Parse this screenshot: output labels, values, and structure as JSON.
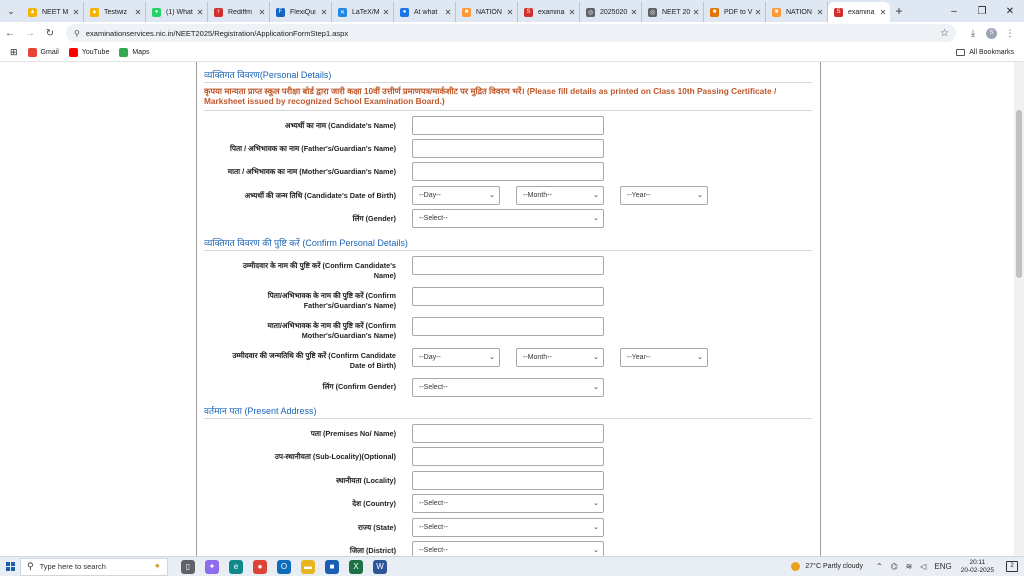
{
  "browser": {
    "tabs": [
      {
        "label": "NEET M",
        "color": "#f4b400",
        "glyph": "▲"
      },
      {
        "label": "Testwiz",
        "color": "#f4b400",
        "glyph": "▲"
      },
      {
        "label": "(1) What",
        "color": "#25d366",
        "glyph": "●"
      },
      {
        "label": "Rediffm",
        "color": "#d32f2f",
        "glyph": "r"
      },
      {
        "label": "FlexiQui",
        "color": "#1565c0",
        "glyph": "F"
      },
      {
        "label": "LaTeX/M",
        "color": "#1e88e5",
        "glyph": "✕"
      },
      {
        "label": "At what",
        "color": "#1a73e8",
        "glyph": "●"
      },
      {
        "label": "NATION",
        "color": "#ff9933",
        "glyph": "■"
      },
      {
        "label": "examina",
        "color": "#d32f2f",
        "glyph": "S"
      },
      {
        "label": "2025020",
        "color": "#5f6368",
        "glyph": "◎"
      },
      {
        "label": "NEET 20",
        "color": "#5f6368",
        "glyph": "◎"
      },
      {
        "label": "PDF to V",
        "color": "#e37400",
        "glyph": "■"
      },
      {
        "label": "NATION",
        "color": "#ff9933",
        "glyph": "■"
      },
      {
        "label": "examina",
        "color": "#d32f2f",
        "glyph": "S",
        "active": true
      }
    ],
    "url": "examinationservices.nic.in/NEET2025/Registration/ApplicationFormStep1.aspx",
    "bookmarks": [
      {
        "label": "Gmail",
        "color": "#ea4335"
      },
      {
        "label": "YouTube",
        "color": "#ff0000"
      },
      {
        "label": "Maps",
        "color": "#34a853"
      }
    ],
    "all_bookmarks": "All Bookmarks",
    "profile_initial": "S"
  },
  "form": {
    "personal_title_hi": "व्यक्तिगत विवरण",
    "personal_title_en": "(Personal Details)",
    "instruction_hi": "कृपया मान्यता प्राप्त स्कूल परीक्षा बोर्ड द्वारा जारी कक्षा 10वीं उत्तीर्ण प्रमाणपत्र/मार्कशीट पर मुद्रित विवरण भरें।",
    "instruction_en": "(Please fill details as printed on Class 10th Passing Certificate / Marksheet issued by recognized School Examination Board.)",
    "labels": {
      "candidate_name": "अभ्यर्थी का नाम (Candidate's Name)",
      "father_name": "पिता / अभिभावक का नाम (Father's/Guardian's Name)",
      "mother_name": "माता / अभिभावक का नाम (Mother's/Guardian's Name)",
      "dob": "अभ्यर्थी की जन्म तिथि (Candidate's Date of Birth)",
      "gender": "लिंग (Gender)",
      "confirm_name_1": "उम्मीदवार के नाम की पुष्टि करें (Confirm Candidate's",
      "confirm_name_2": "Name)",
      "confirm_father_1": "पिता/अभिभावक के नाम की पुष्टि करें (Confirm",
      "confirm_father_2": "Father's/Guardian's Name)",
      "confirm_mother_1": "माता/अभिभावक के नाम की पुष्टि करें (Confirm",
      "confirm_mother_2": "Mother's/Guardian's Name)",
      "confirm_dob_1": "उम्मीदवार की जन्मतिथि की पुष्टि करें (Confirm Candidate",
      "confirm_dob_2": "Date of Birth)",
      "confirm_gender": "लिंग (Confirm Gender)",
      "premises": "पता (Premises No/ Name)",
      "sub_locality": "उप-स्थानीयता (Sub-Locality)(Optional)",
      "locality": "स्थानीयता (Locality)",
      "country": "देश (Country)",
      "state": "राज्य (State)",
      "district": "जिला (District)"
    },
    "confirm_title_hi": "व्यक्तिगत विवरण की पुष्टि करें",
    "confirm_title_en": "(Confirm Personal Details)",
    "address_title_hi": "वर्तमान पता",
    "address_title_en": "(Present Address)",
    "select_day": "--Day--",
    "select_month": "--Month--",
    "select_year": "--Year--",
    "select_default": "--Select--"
  },
  "taskbar": {
    "search_placeholder": "Type here to search",
    "weather": "27°C  Partly cloudy",
    "language": "ENG",
    "time": "20:11",
    "date": "20-02-2025",
    "notification_count": "2",
    "apps": [
      {
        "name": "task-view-icon",
        "color": "#5f6368",
        "glyph": "▯"
      },
      {
        "name": "copilot-icon",
        "color": "#8e6cef",
        "glyph": "✦"
      },
      {
        "name": "edge-icon",
        "color": "#0f8a8a",
        "glyph": "e"
      },
      {
        "name": "chrome-icon",
        "color": "#db4437",
        "glyph": "●"
      },
      {
        "name": "outlook-icon",
        "color": "#0f6cbd",
        "glyph": "O"
      },
      {
        "name": "file-explorer-icon",
        "color": "#e8b422",
        "glyph": "▬"
      },
      {
        "name": "store-icon",
        "color": "#1a5fb4",
        "glyph": "■"
      },
      {
        "name": "excel-icon",
        "color": "#1d7044",
        "glyph": "X"
      },
      {
        "name": "word-icon",
        "color": "#2b5797",
        "glyph": "W"
      }
    ]
  }
}
